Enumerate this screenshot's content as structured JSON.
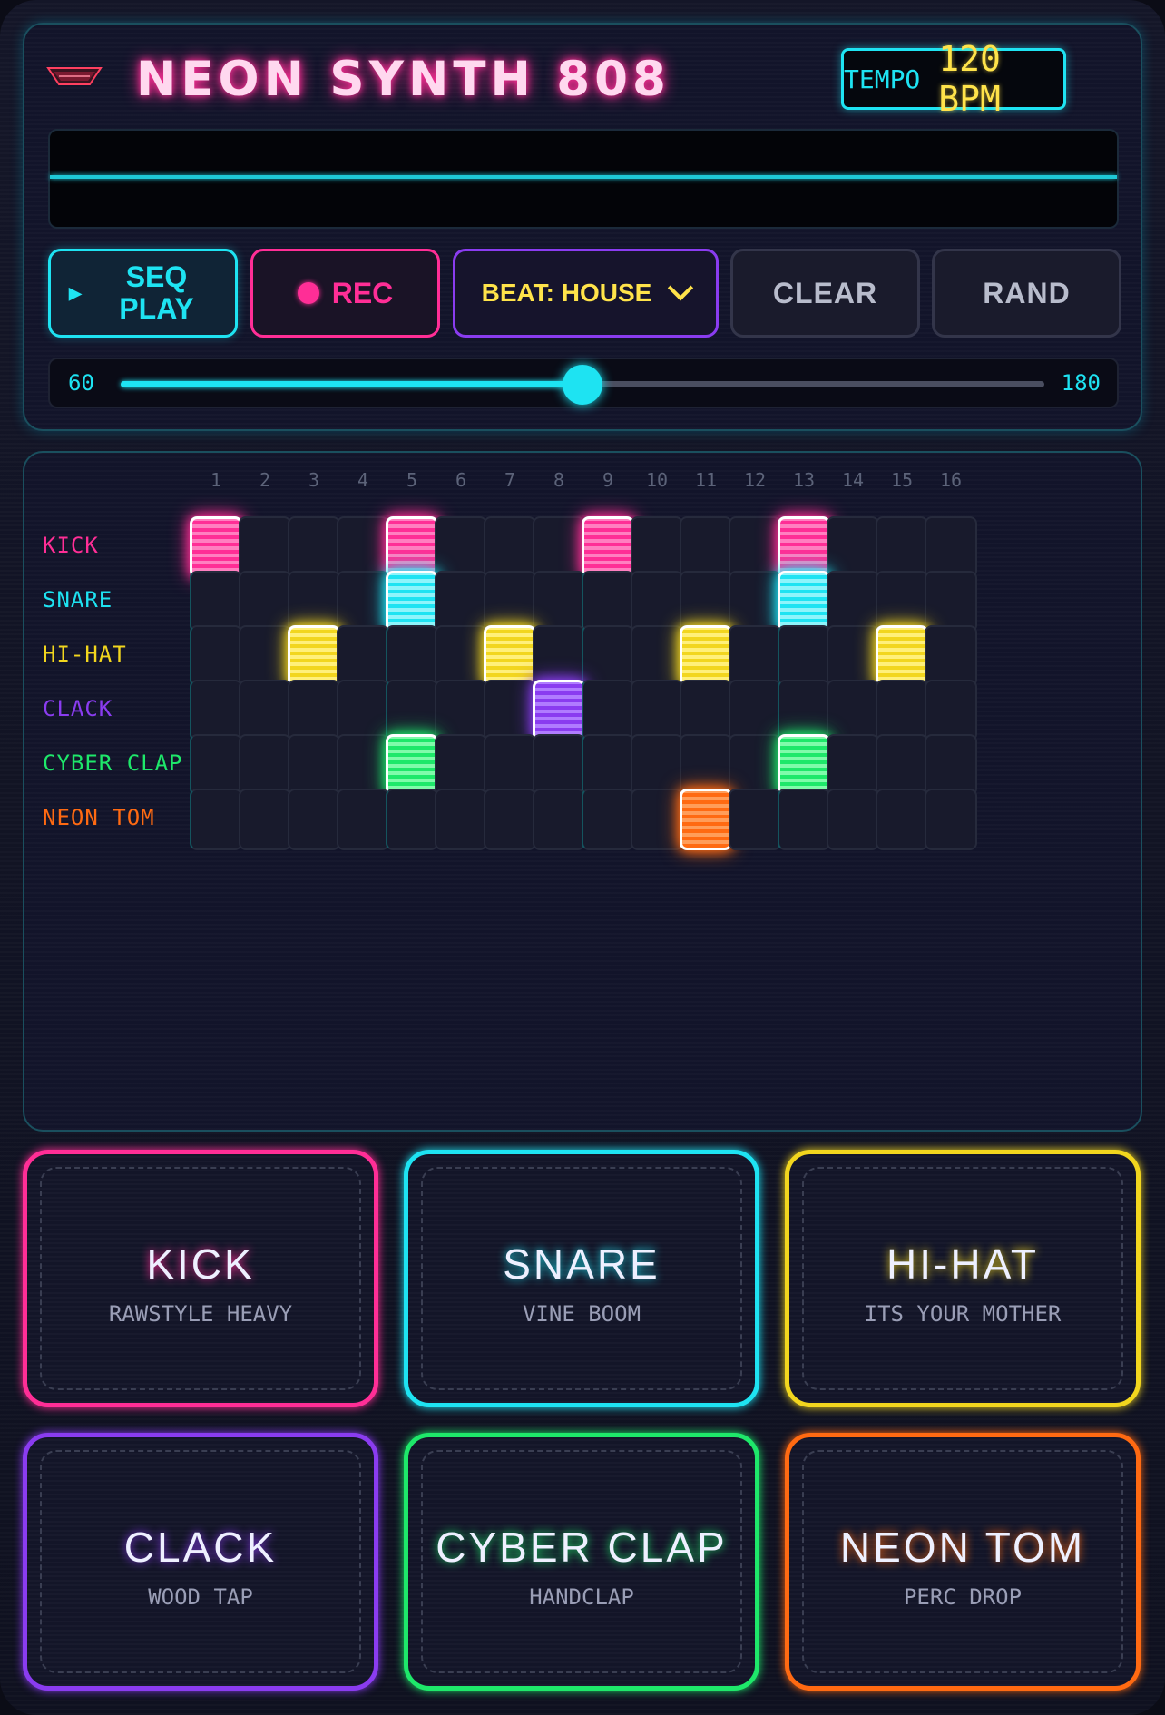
{
  "header": {
    "title": "NEON SYNTH 808",
    "tempo_label": "TEMPO",
    "tempo_value": "120 BPM"
  },
  "controls": {
    "seq_play_label": "SEQ PLAY",
    "rec_label": "REC",
    "beat_label": "BEAT: HOUSE",
    "clear_label": "CLEAR",
    "rand_label": "RAND"
  },
  "tempo_slider": {
    "min_label": "60",
    "max_label": "180",
    "min": 60,
    "max": 180,
    "value": 120
  },
  "sequencer": {
    "steps": [
      "1",
      "2",
      "3",
      "4",
      "5",
      "6",
      "7",
      "8",
      "9",
      "10",
      "11",
      "12",
      "13",
      "14",
      "15",
      "16"
    ],
    "tracks": [
      {
        "label": "KICK",
        "color": "#ff2e96",
        "color2": "#ff7fc0",
        "active_steps": [
          1,
          5,
          9,
          13
        ]
      },
      {
        "label": "SNARE",
        "color": "#1ee3f2",
        "color2": "#8ef4fb",
        "active_steps": [
          5,
          13
        ]
      },
      {
        "label": "HI-HAT",
        "color": "#f2d61e",
        "color2": "#fff07a",
        "active_steps": [
          3,
          7,
          11,
          15
        ]
      },
      {
        "label": "CLACK",
        "color": "#8a3cf0",
        "color2": "#b07cff",
        "active_steps": [
          8
        ]
      },
      {
        "label": "CYBER CLAP",
        "color": "#1ee86a",
        "color2": "#7ffbaa",
        "active_steps": [
          5,
          13
        ]
      },
      {
        "label": "NEON TOM",
        "color": "#ff6a12",
        "color2": "#ff9d5a",
        "active_steps": [
          11
        ]
      }
    ]
  },
  "pads": [
    {
      "name": "KICK",
      "sub": "RAWSTYLE HEAVY",
      "color": "#ff2e96"
    },
    {
      "name": "SNARE",
      "sub": "VINE BOOM",
      "color": "#1ee3f2"
    },
    {
      "name": "HI-HAT",
      "sub": "ITS YOUR MOTHER",
      "color": "#f2d61e"
    },
    {
      "name": "CLACK",
      "sub": "WOOD TAP",
      "color": "#8a3cf0"
    },
    {
      "name": "CYBER CLAP",
      "sub": "HANDCLAP",
      "color": "#1ee86a"
    },
    {
      "name": "NEON TOM",
      "sub": "PERC DROP",
      "color": "#ff6a12"
    }
  ]
}
